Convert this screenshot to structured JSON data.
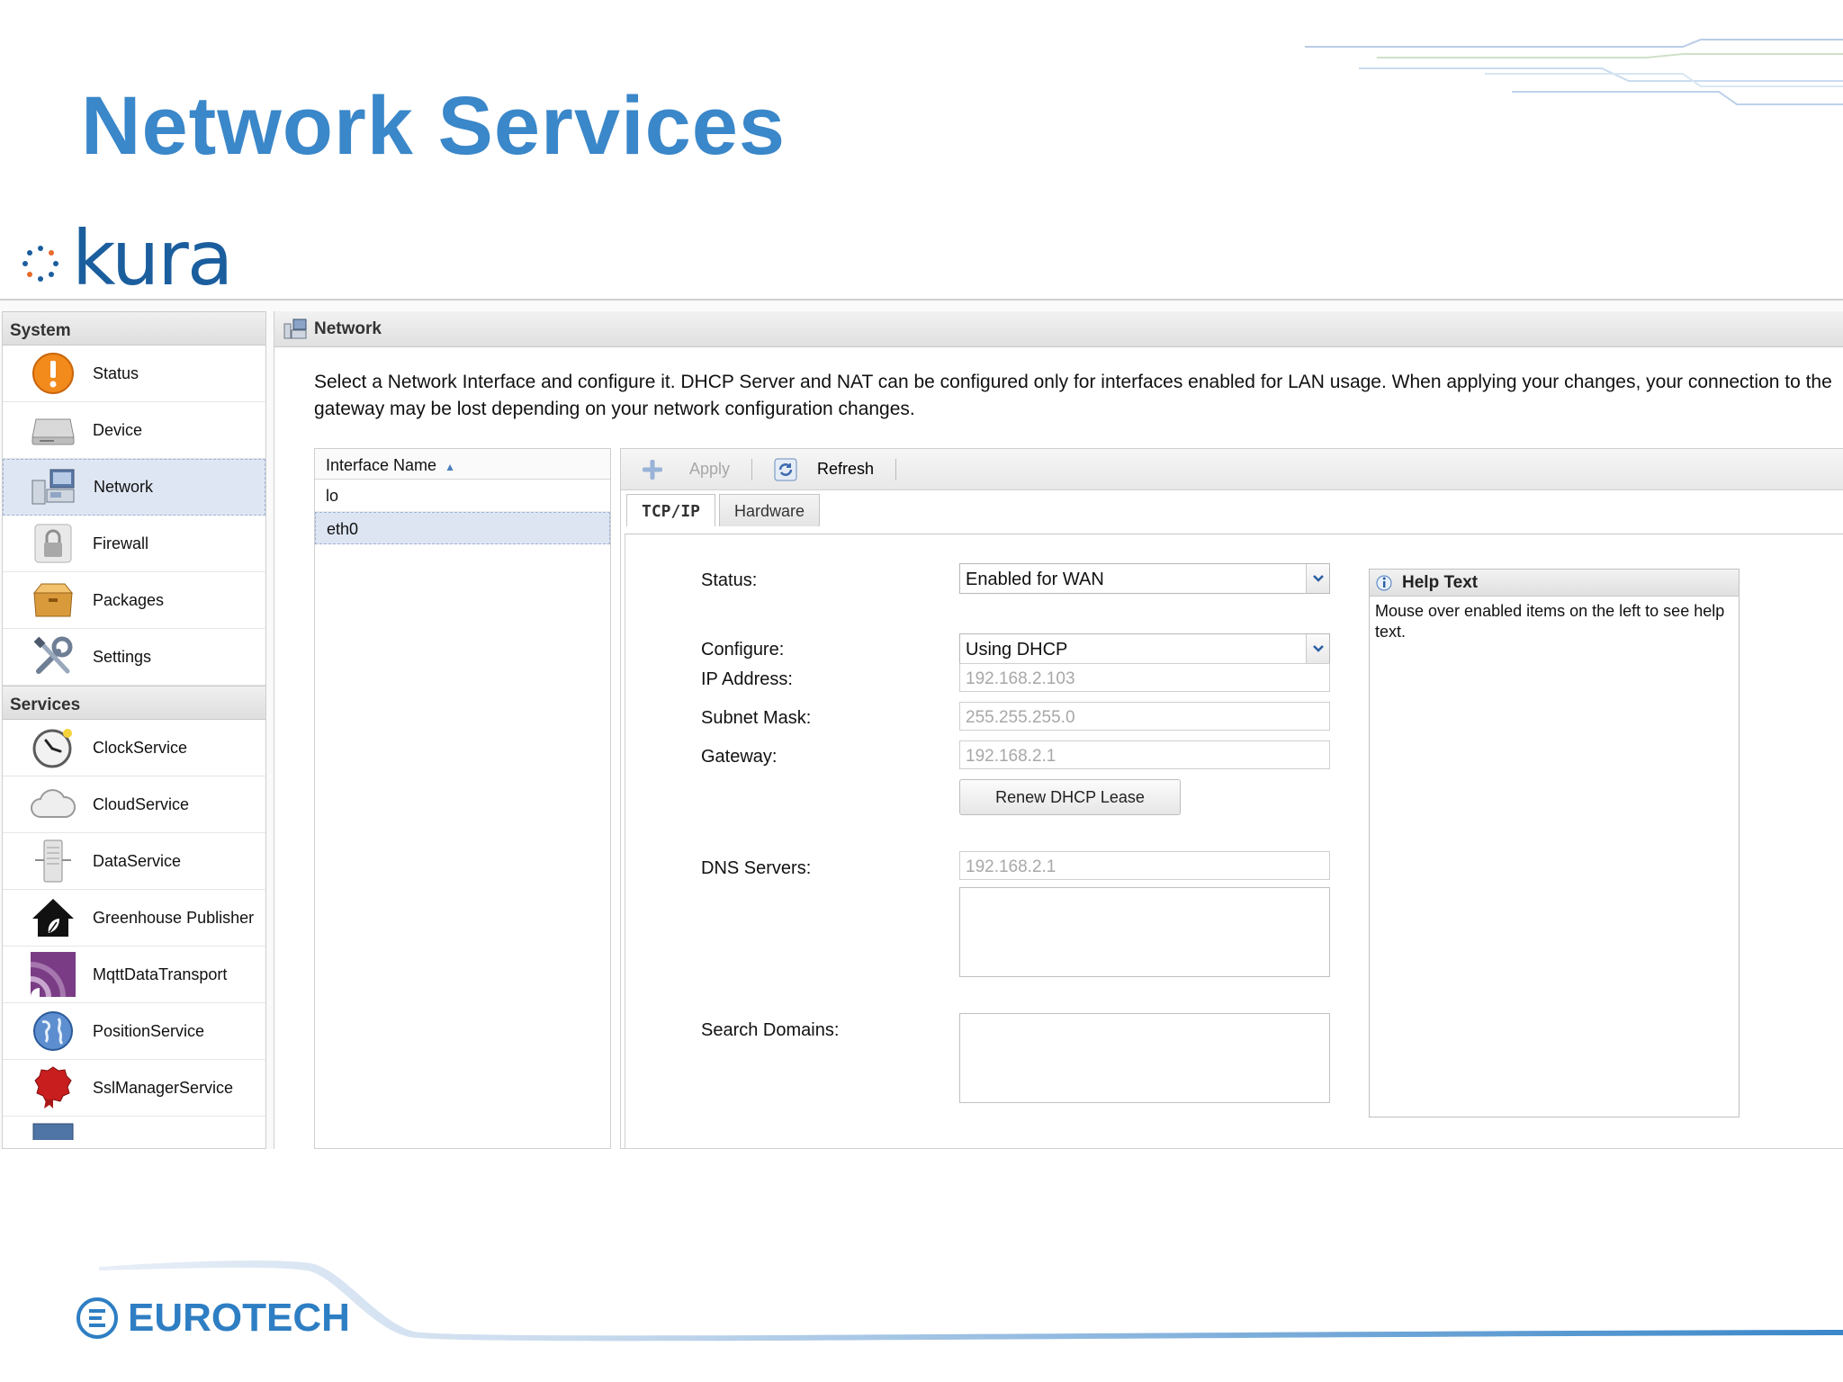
{
  "slide": {
    "title": "Network Services",
    "footer_brand": "EUROTECH",
    "accent_color": "#3a87c9"
  },
  "app": {
    "logo_text": "kura",
    "nav": {
      "system_header": "System",
      "system_items": [
        {
          "label": "Status",
          "icon": "status-alert-icon"
        },
        {
          "label": "Device",
          "icon": "device-icon"
        },
        {
          "label": "Network",
          "icon": "network-icon",
          "selected": true
        },
        {
          "label": "Firewall",
          "icon": "lock-icon"
        },
        {
          "label": "Packages",
          "icon": "package-icon"
        },
        {
          "label": "Settings",
          "icon": "tools-icon"
        }
      ],
      "services_header": "Services",
      "services_items": [
        {
          "label": "ClockService",
          "icon": "clock-icon"
        },
        {
          "label": "CloudService",
          "icon": "cloud-icon"
        },
        {
          "label": "DataService",
          "icon": "server-icon"
        },
        {
          "label": "Greenhouse Publisher",
          "icon": "house-leaf-icon"
        },
        {
          "label": "MqttDataTransport",
          "icon": "signal-icon"
        },
        {
          "label": "PositionService",
          "icon": "globe-icon"
        },
        {
          "label": "SslManagerService",
          "icon": "seal-icon"
        }
      ]
    },
    "panel": {
      "title": "Network",
      "description": "Select a Network Interface and configure it. DHCP Server and NAT can be configured only for interfaces enabled for LAN usage. When applying your changes, your connection to the gateway may be lost depending on your network configuration changes.",
      "interface_table": {
        "header": "Interface Name",
        "rows": [
          "lo",
          "eth0"
        ],
        "selected": "eth0"
      },
      "toolbar": {
        "apply": "Apply",
        "refresh": "Refresh"
      },
      "tabs": [
        "TCP/IP",
        "Hardware"
      ],
      "form": {
        "status_label": "Status:",
        "status_value": "Enabled for WAN",
        "configure_label": "Configure:",
        "configure_value": "Using DHCP",
        "ip_label": "IP Address:",
        "ip_value": "192.168.2.103",
        "subnet_label": "Subnet Mask:",
        "subnet_value": "255.255.255.0",
        "gateway_label": "Gateway:",
        "gateway_value": "192.168.2.1",
        "renew_button": "Renew DHCP Lease",
        "dns_label": "DNS Servers:",
        "dns_value": "192.168.2.1",
        "search_label": "Search Domains:"
      },
      "help": {
        "title": "Help Text",
        "body": "Mouse over enabled items on the left to see help text."
      }
    }
  }
}
